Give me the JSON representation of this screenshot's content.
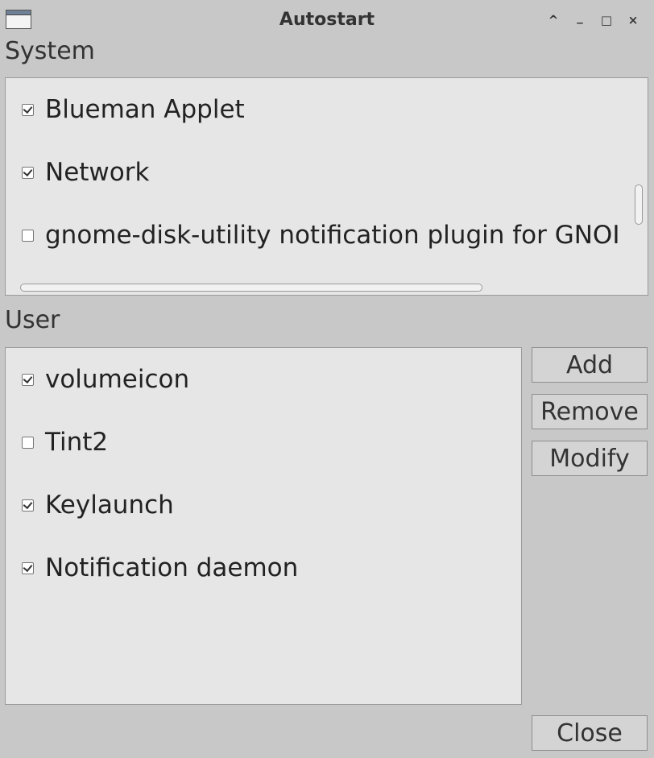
{
  "window": {
    "title": "Autostart",
    "controls": {
      "shade": "^",
      "minimize": "_",
      "maximize": "□",
      "close": "×"
    }
  },
  "system": {
    "label": "System",
    "items": [
      {
        "label": "Blueman Applet",
        "checked": true
      },
      {
        "label": "Network",
        "checked": true
      },
      {
        "label": "gnome-disk-utility notification plugin for GNOI",
        "checked": false
      }
    ]
  },
  "user": {
    "label": "User",
    "items": [
      {
        "label": "volumeicon",
        "checked": true
      },
      {
        "label": "Tint2",
        "checked": false
      },
      {
        "label": "Keylaunch",
        "checked": true
      },
      {
        "label": "Notification daemon",
        "checked": true
      }
    ]
  },
  "buttons": {
    "add": "Add",
    "remove": "Remove",
    "modify": "Modify",
    "close": "Close"
  }
}
